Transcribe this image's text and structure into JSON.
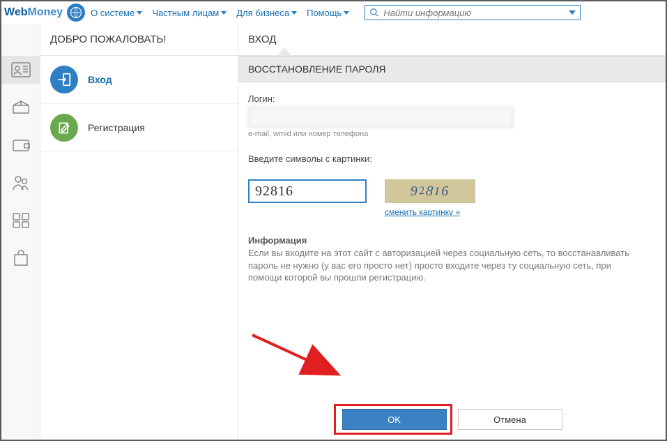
{
  "logo": {
    "part1": "Web",
    "part2": "Money"
  },
  "nav": {
    "items": [
      {
        "label": "О системе"
      },
      {
        "label": "Частным лицам"
      },
      {
        "label": "Для бизнеса"
      },
      {
        "label": "Помощь"
      }
    ]
  },
  "search": {
    "placeholder": "Найти информацию"
  },
  "left": {
    "title": "ДОБРО ПОЖАЛОВАТЬ!",
    "login_label": "Вход",
    "register_label": "Регистрация"
  },
  "main": {
    "title": "ВХОД",
    "panel_title": "ВОССТАНОВЛЕНИЕ ПАРОЛЯ",
    "login_label": "Логин:",
    "login_value": "",
    "login_hint": "e-mail, wmid или номер телефона",
    "captcha_label": "Введите символы с картинки:",
    "captcha_value": "92816",
    "captcha_image": "92816",
    "change_captcha": "сменить картинку »",
    "info_title": "Информация",
    "info_text": "Если вы входите на этот сайт с авторизацией через социальную сеть, то восстанавливать пароль не нужно (у вас его просто нет) просто входите через ту социальную сеть, при помощи которой вы прошли регистрацию.",
    "ok_label": "OK",
    "cancel_label": "Отмена"
  }
}
